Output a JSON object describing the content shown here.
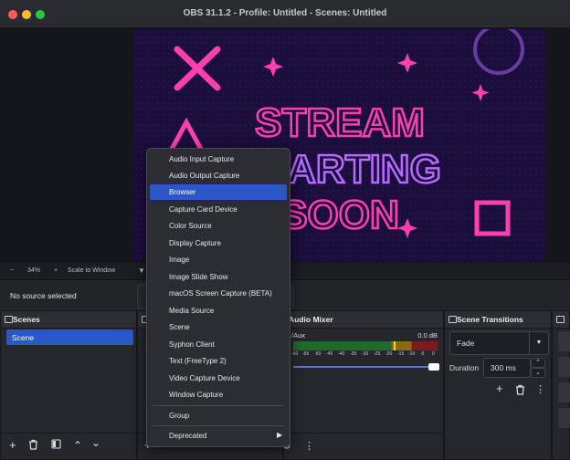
{
  "window": {
    "title": "OBS 31.1.2 - Profile: Untitled - Scenes: Untitled"
  },
  "preview": {
    "canvas_lines": [
      "STREAM",
      "STARTING",
      "SOON"
    ],
    "colors": {
      "bg": "#1b0d3c",
      "neon_pink": "#ff3fb0",
      "neon_purple": "#b66bff"
    }
  },
  "zoombar": {
    "minus": "−",
    "zoom": "34%",
    "plus": "+",
    "scale_label": "Scale to Window"
  },
  "source_bar": {
    "status": "No source selected"
  },
  "scenes": {
    "title": "Scenes",
    "items": [
      "Scene"
    ]
  },
  "context_menu": {
    "items": [
      "Audio Input Capture",
      "Audio Output Capture",
      "Browser",
      "Capture Card Device",
      "Color Source",
      "Display Capture",
      "Image",
      "Image Slide Show",
      "macOS Screen Capture (BETA)",
      "Media Source",
      "Scene",
      "Syphon Client",
      "Text (FreeType 2)",
      "Video Capture Device",
      "Window Capture"
    ],
    "selected": "Browser",
    "group": "Group",
    "deprecated": "Deprecated"
  },
  "mixer": {
    "title": "Audio Mixer",
    "channel": "/Aux",
    "level": "0.0 dB",
    "ticks": [
      "-60",
      "-55",
      "-50",
      "-45",
      "-40",
      "-35",
      "-30",
      "-25",
      "-20",
      "-15",
      "-10",
      "-5",
      "0"
    ]
  },
  "transitions": {
    "title": "Scene Transitions",
    "type": "Fade",
    "duration_label": "Duration",
    "duration_value": "300 ms"
  }
}
